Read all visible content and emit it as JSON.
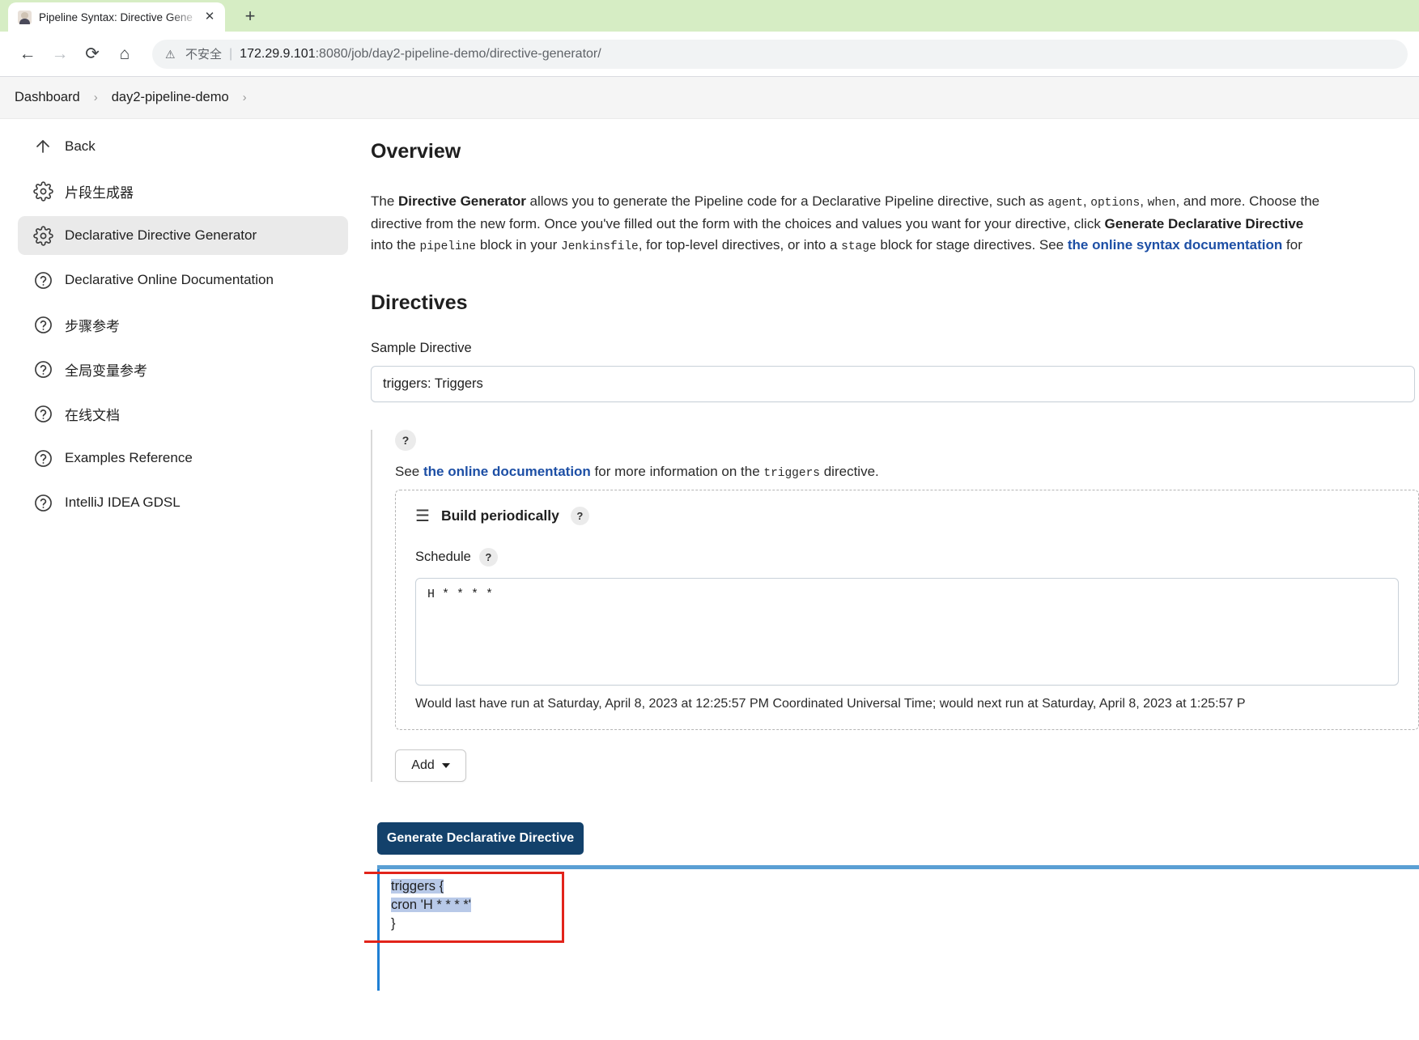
{
  "browser": {
    "tab": {
      "title": "Pipeline Syntax: Directive Gene",
      "close_label": "✕",
      "favicon": "jenkins-favicon"
    },
    "new_tab_label": "+",
    "nav": {
      "back": "←",
      "forward": "→",
      "reload": "⟳",
      "home": "⌂"
    },
    "omnibox": {
      "warning_icon": "⚠",
      "security_text": "不安全",
      "separator": "|",
      "url_host": "172.29.9.101",
      "url_path": ":8080/job/day2-pipeline-demo/directive-generator/"
    }
  },
  "breadcrumb": {
    "items": [
      "Dashboard",
      "day2-pipeline-demo"
    ],
    "separator": "›"
  },
  "sidebar": {
    "items": [
      {
        "label": "Back",
        "icon": "arrow-up-icon",
        "active": false
      },
      {
        "label": "片段生成器",
        "icon": "gear-icon",
        "active": false
      },
      {
        "label": "Declarative Directive Generator",
        "icon": "gear-icon",
        "active": true
      },
      {
        "label": "Declarative Online Documentation",
        "icon": "help-circle-icon",
        "active": false
      },
      {
        "label": "步骤参考",
        "icon": "help-circle-icon",
        "active": false
      },
      {
        "label": "全局变量参考",
        "icon": "help-circle-icon",
        "active": false
      },
      {
        "label": "在线文档",
        "icon": "help-circle-icon",
        "active": false
      },
      {
        "label": "Examples Reference",
        "icon": "help-circle-icon",
        "active": false
      },
      {
        "label": "IntelliJ IDEA GDSL",
        "icon": "help-circle-icon",
        "active": false
      }
    ]
  },
  "overview": {
    "heading": "Overview",
    "p1_a": "The ",
    "p1_bold": "Directive Generator",
    "p1_b": " allows you to generate the Pipeline code for a Declarative Pipeline directive, such as ",
    "code_agent": "agent",
    "code_options": "options",
    "code_when": "when",
    "p1_c": ", and more. Choose the",
    "p2_a": "directive from the new form. Once you've filled out the form with the choices and values you want for your directive, click ",
    "p2_bold": "Generate Declarative Directive",
    "p3_a": "into the ",
    "code_pipeline": "pipeline",
    "p3_b": " block in your ",
    "code_jenkinsfile": "Jenkinsfile",
    "p3_c": ", for top-level directives, or into a ",
    "code_stage": "stage",
    "p3_d": " block for stage directives. See ",
    "p3_link": "the online syntax documentation",
    "p3_e": " for"
  },
  "directives": {
    "heading": "Directives",
    "sample_label": "Sample Directive",
    "sample_value": "triggers: Triggers",
    "help_label": "?",
    "doc_prefix": "See ",
    "doc_link": "the online documentation",
    "doc_mid": " for more information on the ",
    "doc_code": "triggers",
    "doc_suffix": " directive.",
    "panel": {
      "drag_handle": "☰",
      "title": "Build periodically",
      "schedule_label": "Schedule",
      "schedule_value": "H * * * *",
      "hint": "Would last have run at Saturday, April 8, 2023 at 12:25:57 PM Coordinated Universal Time; would next run at Saturday, April 8, 2023 at 1:25:57 P"
    },
    "add_label": "Add",
    "generate_label": "Generate Declarative Directive"
  },
  "result": {
    "line1": "triggers {",
    "line2": "cron 'H * * * *'",
    "line3": "}"
  },
  "colors": {
    "accent": "#13416b",
    "link": "#1d4fa5",
    "highlight": "#b8c9e8",
    "annotation": "#e2231a",
    "tabstrip": "#d6edc4"
  }
}
